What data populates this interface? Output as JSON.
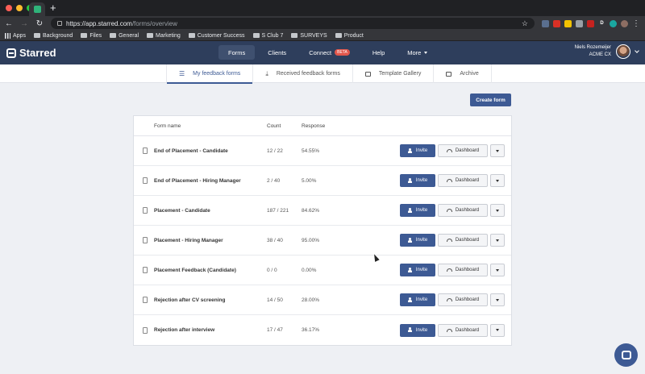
{
  "browser": {
    "url_host": "https://app.starred.com",
    "url_path": "/forms/overview",
    "new_tab_symbol": "+",
    "bookmarks": [
      "Apps",
      "Background",
      "Files",
      "General",
      "Marketing",
      "Customer Success",
      "S Club 7",
      "SURVEYS",
      "Product"
    ],
    "ext_labels": [
      "",
      "",
      "",
      "",
      "",
      "D",
      "",
      ""
    ],
    "traffic_colors": [
      "#ff5f57",
      "#febc2e",
      "#28c840"
    ]
  },
  "app": {
    "brand": "Starred",
    "nav": [
      {
        "label": "Forms",
        "active": true
      },
      {
        "label": "Clients",
        "active": false
      },
      {
        "label": "Connect",
        "badge": "BETA",
        "active": false
      },
      {
        "label": "Help",
        "active": false
      },
      {
        "label": "More",
        "active": false
      }
    ],
    "user_name": "Niels Rozemeijer",
    "user_company": "ACME CX",
    "accent_color": "#3d5a94",
    "header_color": "#2e3e5c"
  },
  "subnav": [
    {
      "label": "My feedback forms",
      "active": true
    },
    {
      "label": "Received feedback forms",
      "active": false
    },
    {
      "label": "Template Gallery",
      "active": false
    },
    {
      "label": "Archive",
      "active": false
    }
  ],
  "create_label": "Create form",
  "table": {
    "headers": {
      "name": "Form name",
      "count": "Count",
      "response": "Response"
    },
    "invite_label": "Invite",
    "dashboard_label": "Dashboard",
    "rows": [
      {
        "name": "End of Placement - Candidate",
        "count": "12 / 22",
        "response": "54.55%"
      },
      {
        "name": "End of Placement - Hiring Manager",
        "count": "2 / 40",
        "response": "5.00%"
      },
      {
        "name": "Placement - Candidate",
        "count": "187 / 221",
        "response": "84.62%"
      },
      {
        "name": "Placement - Hiring Manager",
        "count": "38 / 40",
        "response": "95.00%"
      },
      {
        "name": "Placement Feedback (Candidate)",
        "count": "0 / 0",
        "response": "0.00%"
      },
      {
        "name": "Rejection after CV screening",
        "count": "14 / 50",
        "response": "28.00%"
      },
      {
        "name": "Rejection after interview",
        "count": "17 / 47",
        "response": "36.17%"
      }
    ]
  }
}
